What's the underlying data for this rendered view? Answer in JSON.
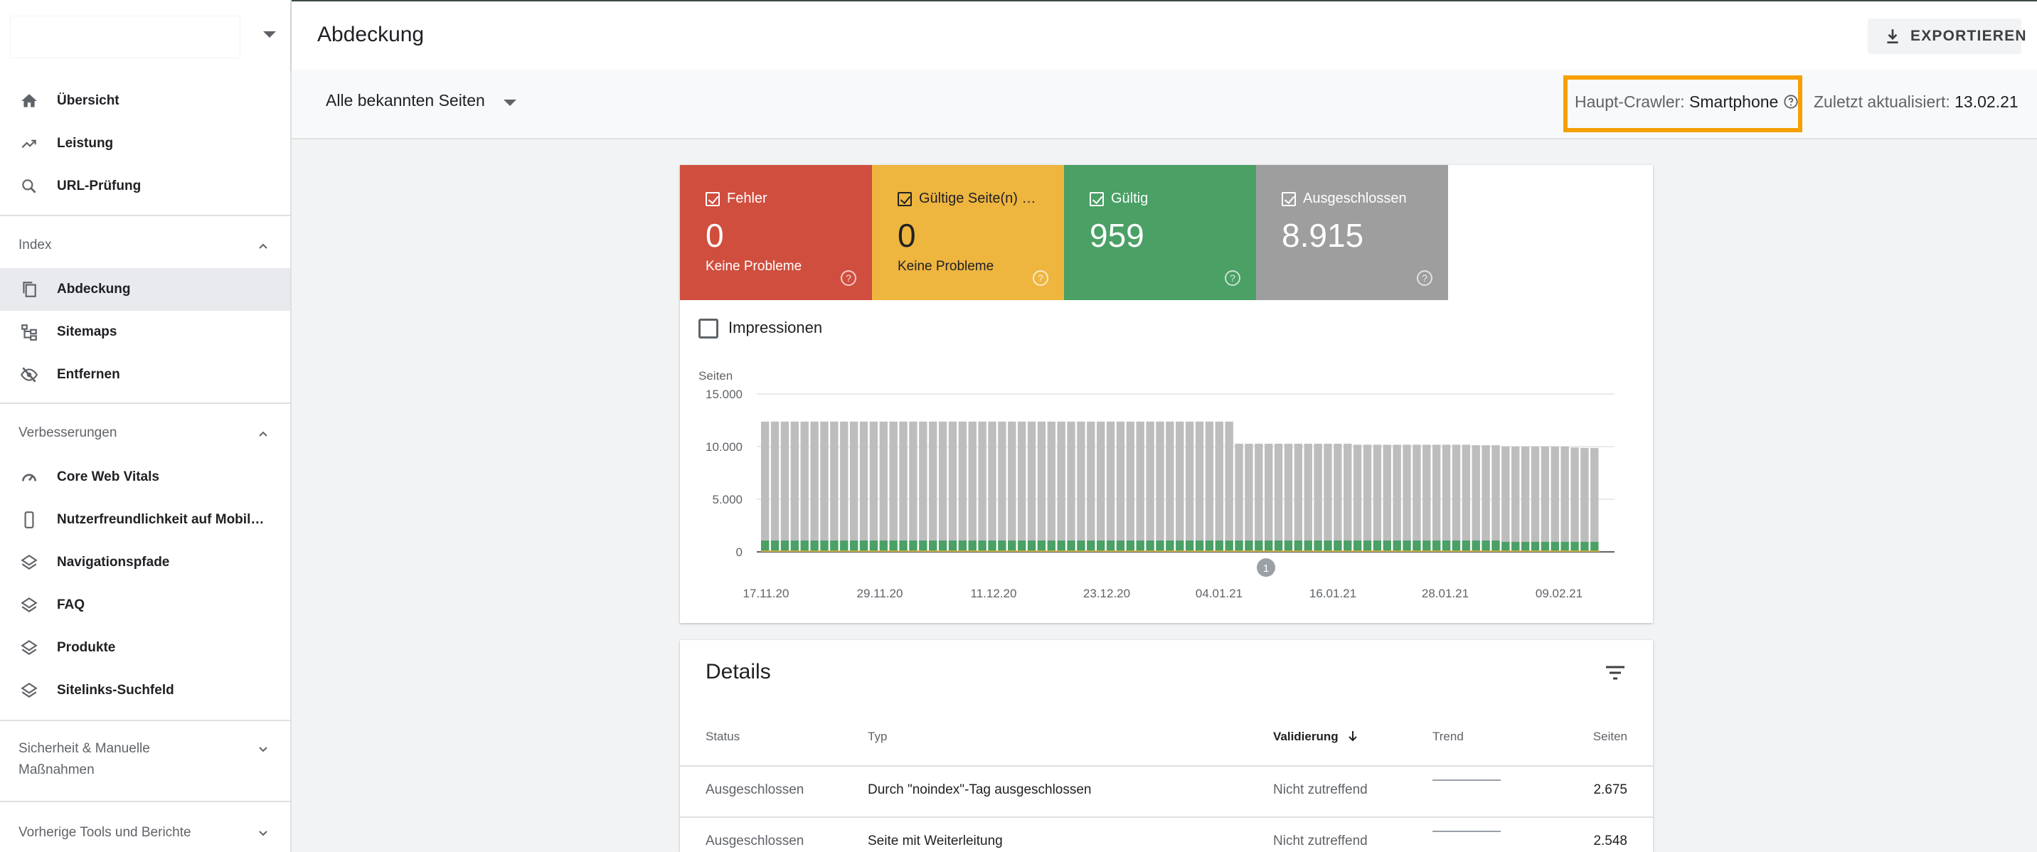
{
  "sidebar": {
    "items": [
      {
        "label": "Übersicht",
        "icon": "home-icon"
      },
      {
        "label": "Leistung",
        "icon": "trending-up-icon"
      },
      {
        "label": "URL-Prüfung",
        "icon": "search-icon"
      }
    ],
    "sections": [
      {
        "title": "Index",
        "items": [
          {
            "label": "Abdeckung",
            "icon": "copy-pages-icon",
            "active": true
          },
          {
            "label": "Sitemaps",
            "icon": "sitemap-icon"
          },
          {
            "label": "Entfernen",
            "icon": "eye-off-icon"
          }
        ]
      },
      {
        "title": "Verbesserungen",
        "items": [
          {
            "label": "Core Web Vitals",
            "icon": "gauge-icon"
          },
          {
            "label": "Nutzerfreundlichkeit auf Mobil…",
            "icon": "smartphone-icon"
          },
          {
            "label": "Navigationspfade",
            "icon": "layers-icon"
          },
          {
            "label": "FAQ",
            "icon": "layers-icon"
          },
          {
            "label": "Produkte",
            "icon": "layers-icon"
          },
          {
            "label": "Sitelinks-Suchfeld",
            "icon": "layers-icon"
          }
        ]
      }
    ],
    "security_line1": "Sicherheit & Manuelle",
    "security_line2": "Maßnahmen",
    "legacy": "Vorherige Tools und Berichte"
  },
  "header": {
    "title": "Abdeckung",
    "export_label": "EXPORTIEREN"
  },
  "filterbar": {
    "scope": "Alle bekannten Seiten",
    "crawler_label": "Haupt-Crawler:",
    "crawler_value": "Smartphone",
    "updated_label": "Zuletzt aktualisiert:",
    "updated_value": "13.02.21"
  },
  "tiles": [
    {
      "title": "Fehler",
      "value": "0",
      "sub": "Keine Probleme",
      "color": "#d04e3e"
    },
    {
      "title": "Gültige Seite(n) …",
      "value": "0",
      "sub": "Keine Probleme",
      "color": "#eeb53f"
    },
    {
      "title": "Gültig",
      "value": "959",
      "sub": "",
      "color": "#4aa065"
    },
    {
      "title": "Ausgeschlossen",
      "value": "8.915",
      "sub": "",
      "color": "#9e9e9e"
    }
  ],
  "impressions_label": "Impressionen",
  "chart_data": {
    "type": "bar",
    "ylabel": "Seiten",
    "ylim": [
      0,
      15000
    ],
    "yticks": [
      "15.000",
      "10.000",
      "5.000",
      "0"
    ],
    "xticks": [
      "17.11.20",
      "29.11.20",
      "11.12.20",
      "23.12.20",
      "04.01.21",
      "16.01.21",
      "28.01.21",
      "09.02.21"
    ],
    "stacked": true,
    "annotation": "1",
    "grid": true,
    "series": [
      {
        "name": "Gültig",
        "color": "#4aa065",
        "values": [
          1080,
          1080,
          1080,
          1080,
          1080,
          1080,
          1080,
          1080,
          1080,
          1080,
          1080,
          1080,
          1080,
          1080,
          1080,
          1080,
          1080,
          1080,
          1080,
          1080,
          1080,
          1080,
          1080,
          1080,
          1080,
          1080,
          1080,
          1080,
          1080,
          1080,
          1080,
          1080,
          1080,
          1080,
          1080,
          1080,
          1080,
          1080,
          1080,
          1080,
          1080,
          1080,
          1080,
          1080,
          1080,
          1080,
          1080,
          1080,
          1080,
          1080,
          1080,
          1080,
          1080,
          1080,
          1080,
          1080,
          1080,
          1080,
          1080,
          1080,
          1080,
          1080,
          1080,
          1080,
          1080,
          1080,
          1080,
          1080,
          1080,
          1080,
          1080,
          1080,
          1080,
          1080,
          1080,
          959,
          959,
          959,
          959,
          959,
          959,
          959,
          959,
          959,
          959
        ]
      },
      {
        "name": "Ausgeschlossen",
        "color": "#bdbdbd",
        "values": [
          11300,
          11300,
          11300,
          11300,
          11300,
          11300,
          11300,
          11300,
          11300,
          11300,
          11300,
          11300,
          11300,
          11300,
          11300,
          11300,
          11300,
          11300,
          11300,
          11300,
          11300,
          11300,
          11300,
          11300,
          11300,
          11300,
          11300,
          11300,
          11300,
          11300,
          11300,
          11300,
          11300,
          11300,
          11300,
          11300,
          11300,
          11300,
          11300,
          11300,
          11300,
          11300,
          11300,
          11300,
          11300,
          11300,
          11300,
          11300,
          9200,
          9200,
          9200,
          9200,
          9200,
          9200,
          9200,
          9200,
          9200,
          9200,
          9200,
          9200,
          9100,
          9100,
          9100,
          9100,
          9100,
          9100,
          9100,
          9100,
          9100,
          9100,
          9100,
          9100,
          9050,
          9050,
          9050,
          9050,
          9050,
          9050,
          9050,
          9050,
          9050,
          9050,
          8950,
          8915,
          8915
        ]
      }
    ]
  },
  "details": {
    "title": "Details",
    "columns": [
      "Status",
      "Typ",
      "Validierung",
      "Trend",
      "Seiten"
    ],
    "rows": [
      {
        "status": "Ausgeschlossen",
        "type": "Durch \"noindex\"-Tag ausgeschlossen",
        "validation": "Nicht zutreffend",
        "pages": "2.675"
      },
      {
        "status": "Ausgeschlossen",
        "type": "Seite mit Weiterleitung",
        "validation": "Nicht zutreffend",
        "pages": "2.548"
      }
    ]
  }
}
